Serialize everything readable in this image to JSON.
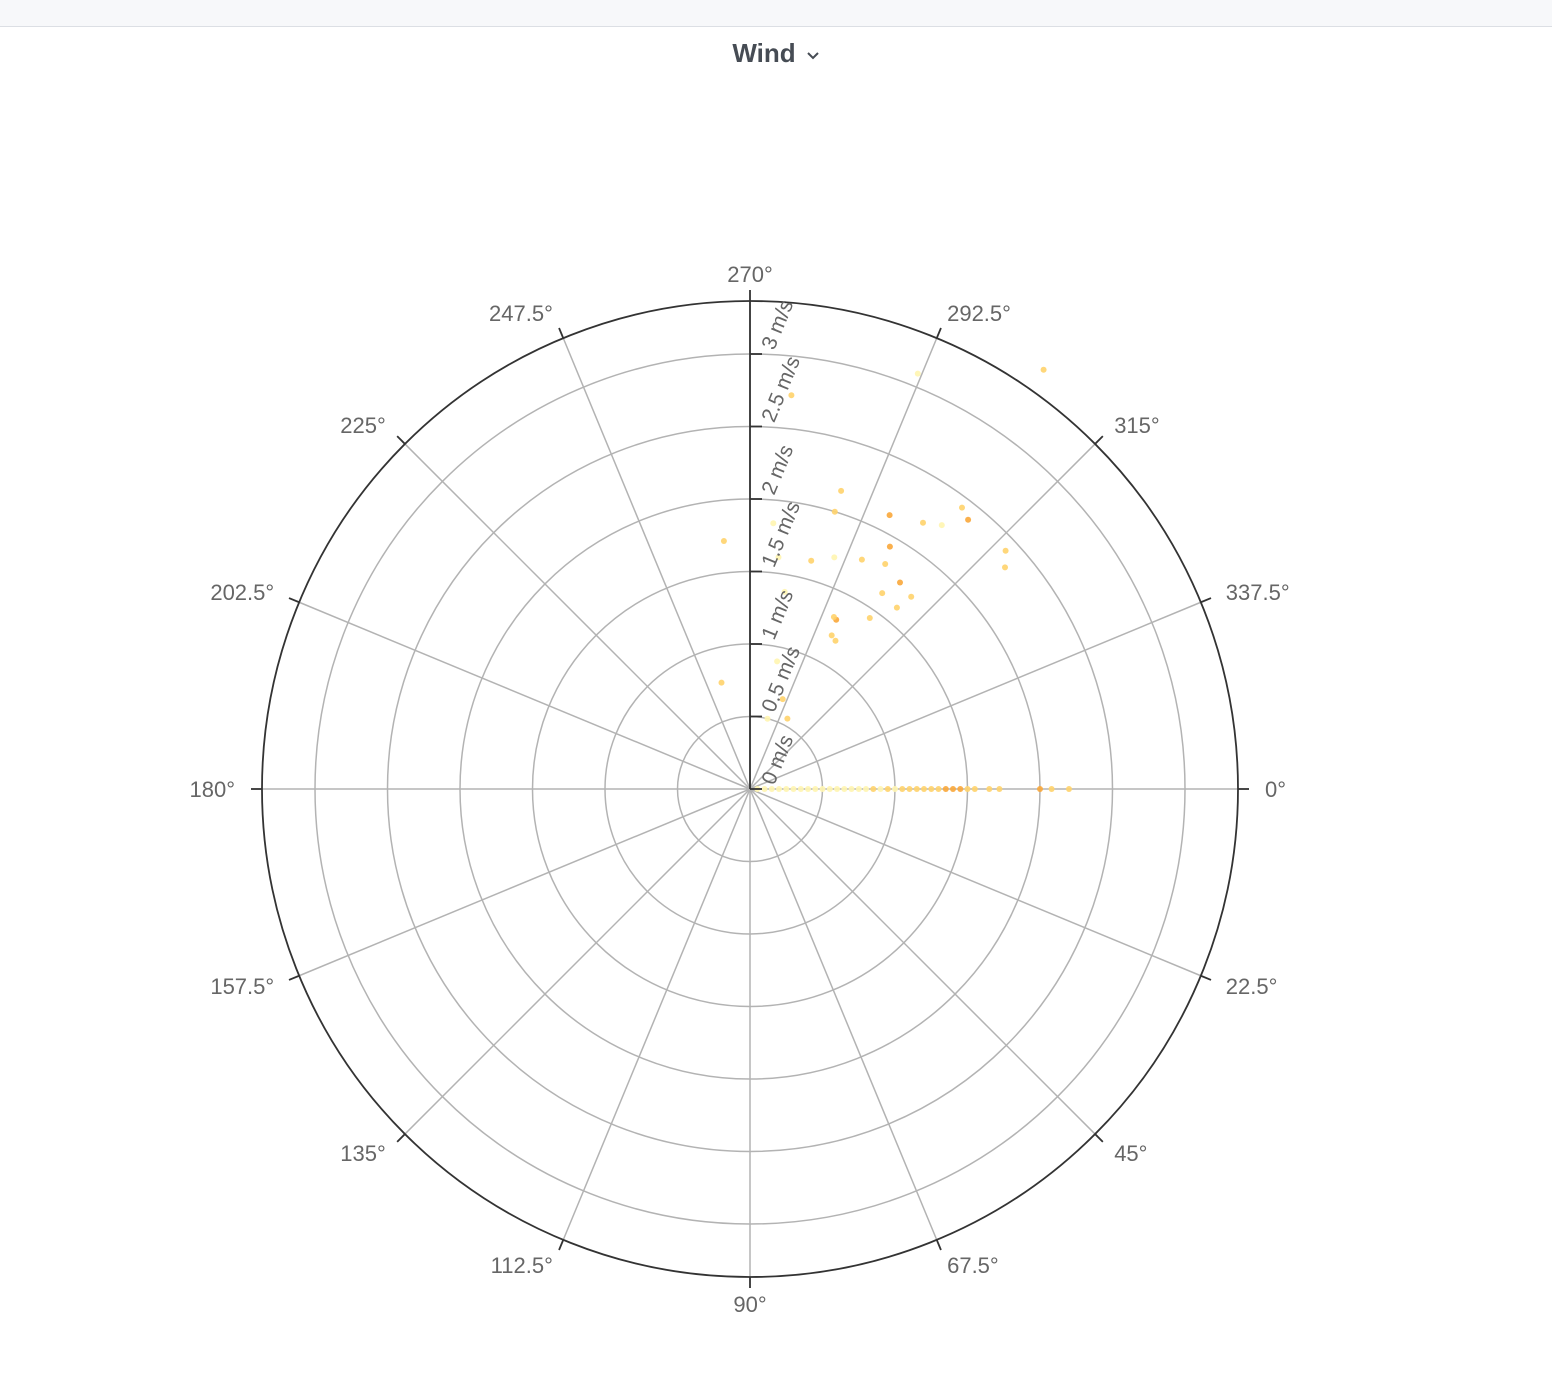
{
  "panel": {
    "title": "Wind",
    "dropdown_icon": "chevron-down-icon"
  },
  "chart_data": {
    "type": "scatter",
    "coordinate_system": "polar",
    "title": "Wind",
    "angular_axis": {
      "unit": "degrees",
      "direction": "clockwise",
      "zero_position": "right",
      "ticks": [
        0,
        22.5,
        45,
        67.5,
        90,
        112.5,
        135,
        157.5,
        180,
        202.5,
        225,
        247.5,
        270,
        292.5,
        315,
        337.5
      ],
      "tick_labels": [
        "0°",
        "22.5°",
        "45°",
        "67.5°",
        "90°",
        "112.5°",
        "135°",
        "157.5°",
        "180°",
        "202.5°",
        "225°",
        "247.5°",
        "270°",
        "292.5°",
        "315°",
        "337.5°"
      ]
    },
    "radial_axis": {
      "unit": "m/s",
      "range": [
        0,
        3.4
      ],
      "ticks": [
        0,
        0.5,
        1,
        1.5,
        2,
        2.5,
        3
      ],
      "tick_labels": [
        "0 m/s",
        "0.5 m/s",
        "1 m/s",
        "1.5 m/s",
        "2 m/s",
        "2.5 m/s",
        "3 m/s"
      ]
    },
    "colors": {
      "light": "#fff5b0",
      "mid": "#ffd36b",
      "dark": "#f9a73a",
      "axis": "#333333",
      "grid": "#b3b3b3"
    },
    "points": [
      {
        "angle": 0,
        "speed": 0.05,
        "level": 0
      },
      {
        "angle": 0,
        "speed": 0.1,
        "level": 0
      },
      {
        "angle": 0,
        "speed": 0.15,
        "level": 0
      },
      {
        "angle": 0,
        "speed": 0.2,
        "level": 0
      },
      {
        "angle": 0,
        "speed": 0.25,
        "level": 0
      },
      {
        "angle": 0,
        "speed": 0.3,
        "level": 0
      },
      {
        "angle": 0,
        "speed": 0.35,
        "level": 0
      },
      {
        "angle": 0,
        "speed": 0.4,
        "level": 0
      },
      {
        "angle": 0,
        "speed": 0.45,
        "level": 0
      },
      {
        "angle": 0,
        "speed": 0.5,
        "level": 0
      },
      {
        "angle": 0,
        "speed": 0.55,
        "level": 0
      },
      {
        "angle": 0,
        "speed": 0.6,
        "level": 0
      },
      {
        "angle": 0,
        "speed": 0.65,
        "level": 0
      },
      {
        "angle": 0,
        "speed": 0.7,
        "level": 0
      },
      {
        "angle": 0,
        "speed": 0.75,
        "level": 0
      },
      {
        "angle": 0,
        "speed": 0.8,
        "level": 0
      },
      {
        "angle": 0,
        "speed": 0.85,
        "level": 1
      },
      {
        "angle": 0,
        "speed": 0.9,
        "level": 0
      },
      {
        "angle": 0,
        "speed": 0.95,
        "level": 1
      },
      {
        "angle": 0,
        "speed": 1.0,
        "level": 0
      },
      {
        "angle": 0,
        "speed": 1.05,
        "level": 1
      },
      {
        "angle": 0,
        "speed": 1.1,
        "level": 1
      },
      {
        "angle": 0,
        "speed": 1.15,
        "level": 1
      },
      {
        "angle": 0,
        "speed": 1.2,
        "level": 1
      },
      {
        "angle": 0,
        "speed": 1.25,
        "level": 1
      },
      {
        "angle": 0,
        "speed": 1.3,
        "level": 1
      },
      {
        "angle": 0,
        "speed": 1.35,
        "level": 2
      },
      {
        "angle": 0,
        "speed": 1.4,
        "level": 2
      },
      {
        "angle": 0,
        "speed": 1.45,
        "level": 2
      },
      {
        "angle": 0,
        "speed": 1.5,
        "level": 1
      },
      {
        "angle": 0,
        "speed": 1.55,
        "level": 1
      },
      {
        "angle": 0,
        "speed": 1.65,
        "level": 1
      },
      {
        "angle": 0,
        "speed": 1.72,
        "level": 1
      },
      {
        "angle": 0,
        "speed": 2.0,
        "level": 2
      },
      {
        "angle": 0,
        "speed": 2.08,
        "level": 1
      },
      {
        "angle": 0,
        "speed": 2.2,
        "level": 1
      },
      {
        "angle": 298,
        "speed": 0.55,
        "level": 1
      },
      {
        "angle": 284,
        "speed": 0.5,
        "level": 0
      },
      {
        "angle": 290,
        "speed": 0.66,
        "level": 1
      },
      {
        "angle": 282,
        "speed": 0.9,
        "level": 0
      },
      {
        "angle": 298,
        "speed": 1.2,
        "level": 1
      },
      {
        "angle": 297,
        "speed": 1.31,
        "level": 2
      },
      {
        "angle": 296,
        "speed": 1.32,
        "level": 1
      },
      {
        "angle": 300,
        "speed": 1.18,
        "level": 1
      },
      {
        "angle": 280,
        "speed": 1.38,
        "level": 0
      },
      {
        "angle": 285,
        "speed": 1.63,
        "level": 1
      },
      {
        "angle": 290,
        "speed": 1.7,
        "level": 0
      },
      {
        "angle": 305,
        "speed": 1.44,
        "level": 1
      },
      {
        "angle": 304,
        "speed": 1.63,
        "level": 1
      },
      {
        "angle": 309,
        "speed": 1.61,
        "level": 1
      },
      {
        "angle": 310,
        "speed": 1.73,
        "level": 1
      },
      {
        "angle": 306,
        "speed": 1.76,
        "level": 2
      },
      {
        "angle": 296,
        "speed": 1.76,
        "level": 1
      },
      {
        "angle": 301,
        "speed": 1.81,
        "level": 1
      },
      {
        "angle": 300,
        "speed": 1.93,
        "level": 2
      },
      {
        "angle": 275,
        "speed": 1.84,
        "level": 0
      },
      {
        "angle": 277,
        "speed": 1.61,
        "level": 0
      },
      {
        "angle": 297,
        "speed": 2.12,
        "level": 2
      },
      {
        "angle": 303,
        "speed": 2.19,
        "level": 1
      },
      {
        "angle": 306,
        "speed": 2.25,
        "level": 0
      },
      {
        "angle": 307,
        "speed": 2.43,
        "level": 1
      },
      {
        "angle": 309,
        "speed": 2.39,
        "level": 2
      },
      {
        "angle": 287,
        "speed": 2.0,
        "level": 1
      },
      {
        "angle": 287,
        "speed": 2.15,
        "level": 1
      },
      {
        "angle": 319,
        "speed": 2.33,
        "level": 1
      },
      {
        "angle": 317,
        "speed": 2.41,
        "level": 1
      },
      {
        "angle": 264,
        "speed": 1.72,
        "level": 1
      },
      {
        "angle": 255,
        "speed": 0.76,
        "level": 1
      },
      {
        "angle": 276,
        "speed": 2.73,
        "level": 1
      },
      {
        "angle": 292,
        "speed": 3.09,
        "level": 0
      },
      {
        "angle": 305,
        "speed": 3.53,
        "level": 1
      }
    ]
  }
}
